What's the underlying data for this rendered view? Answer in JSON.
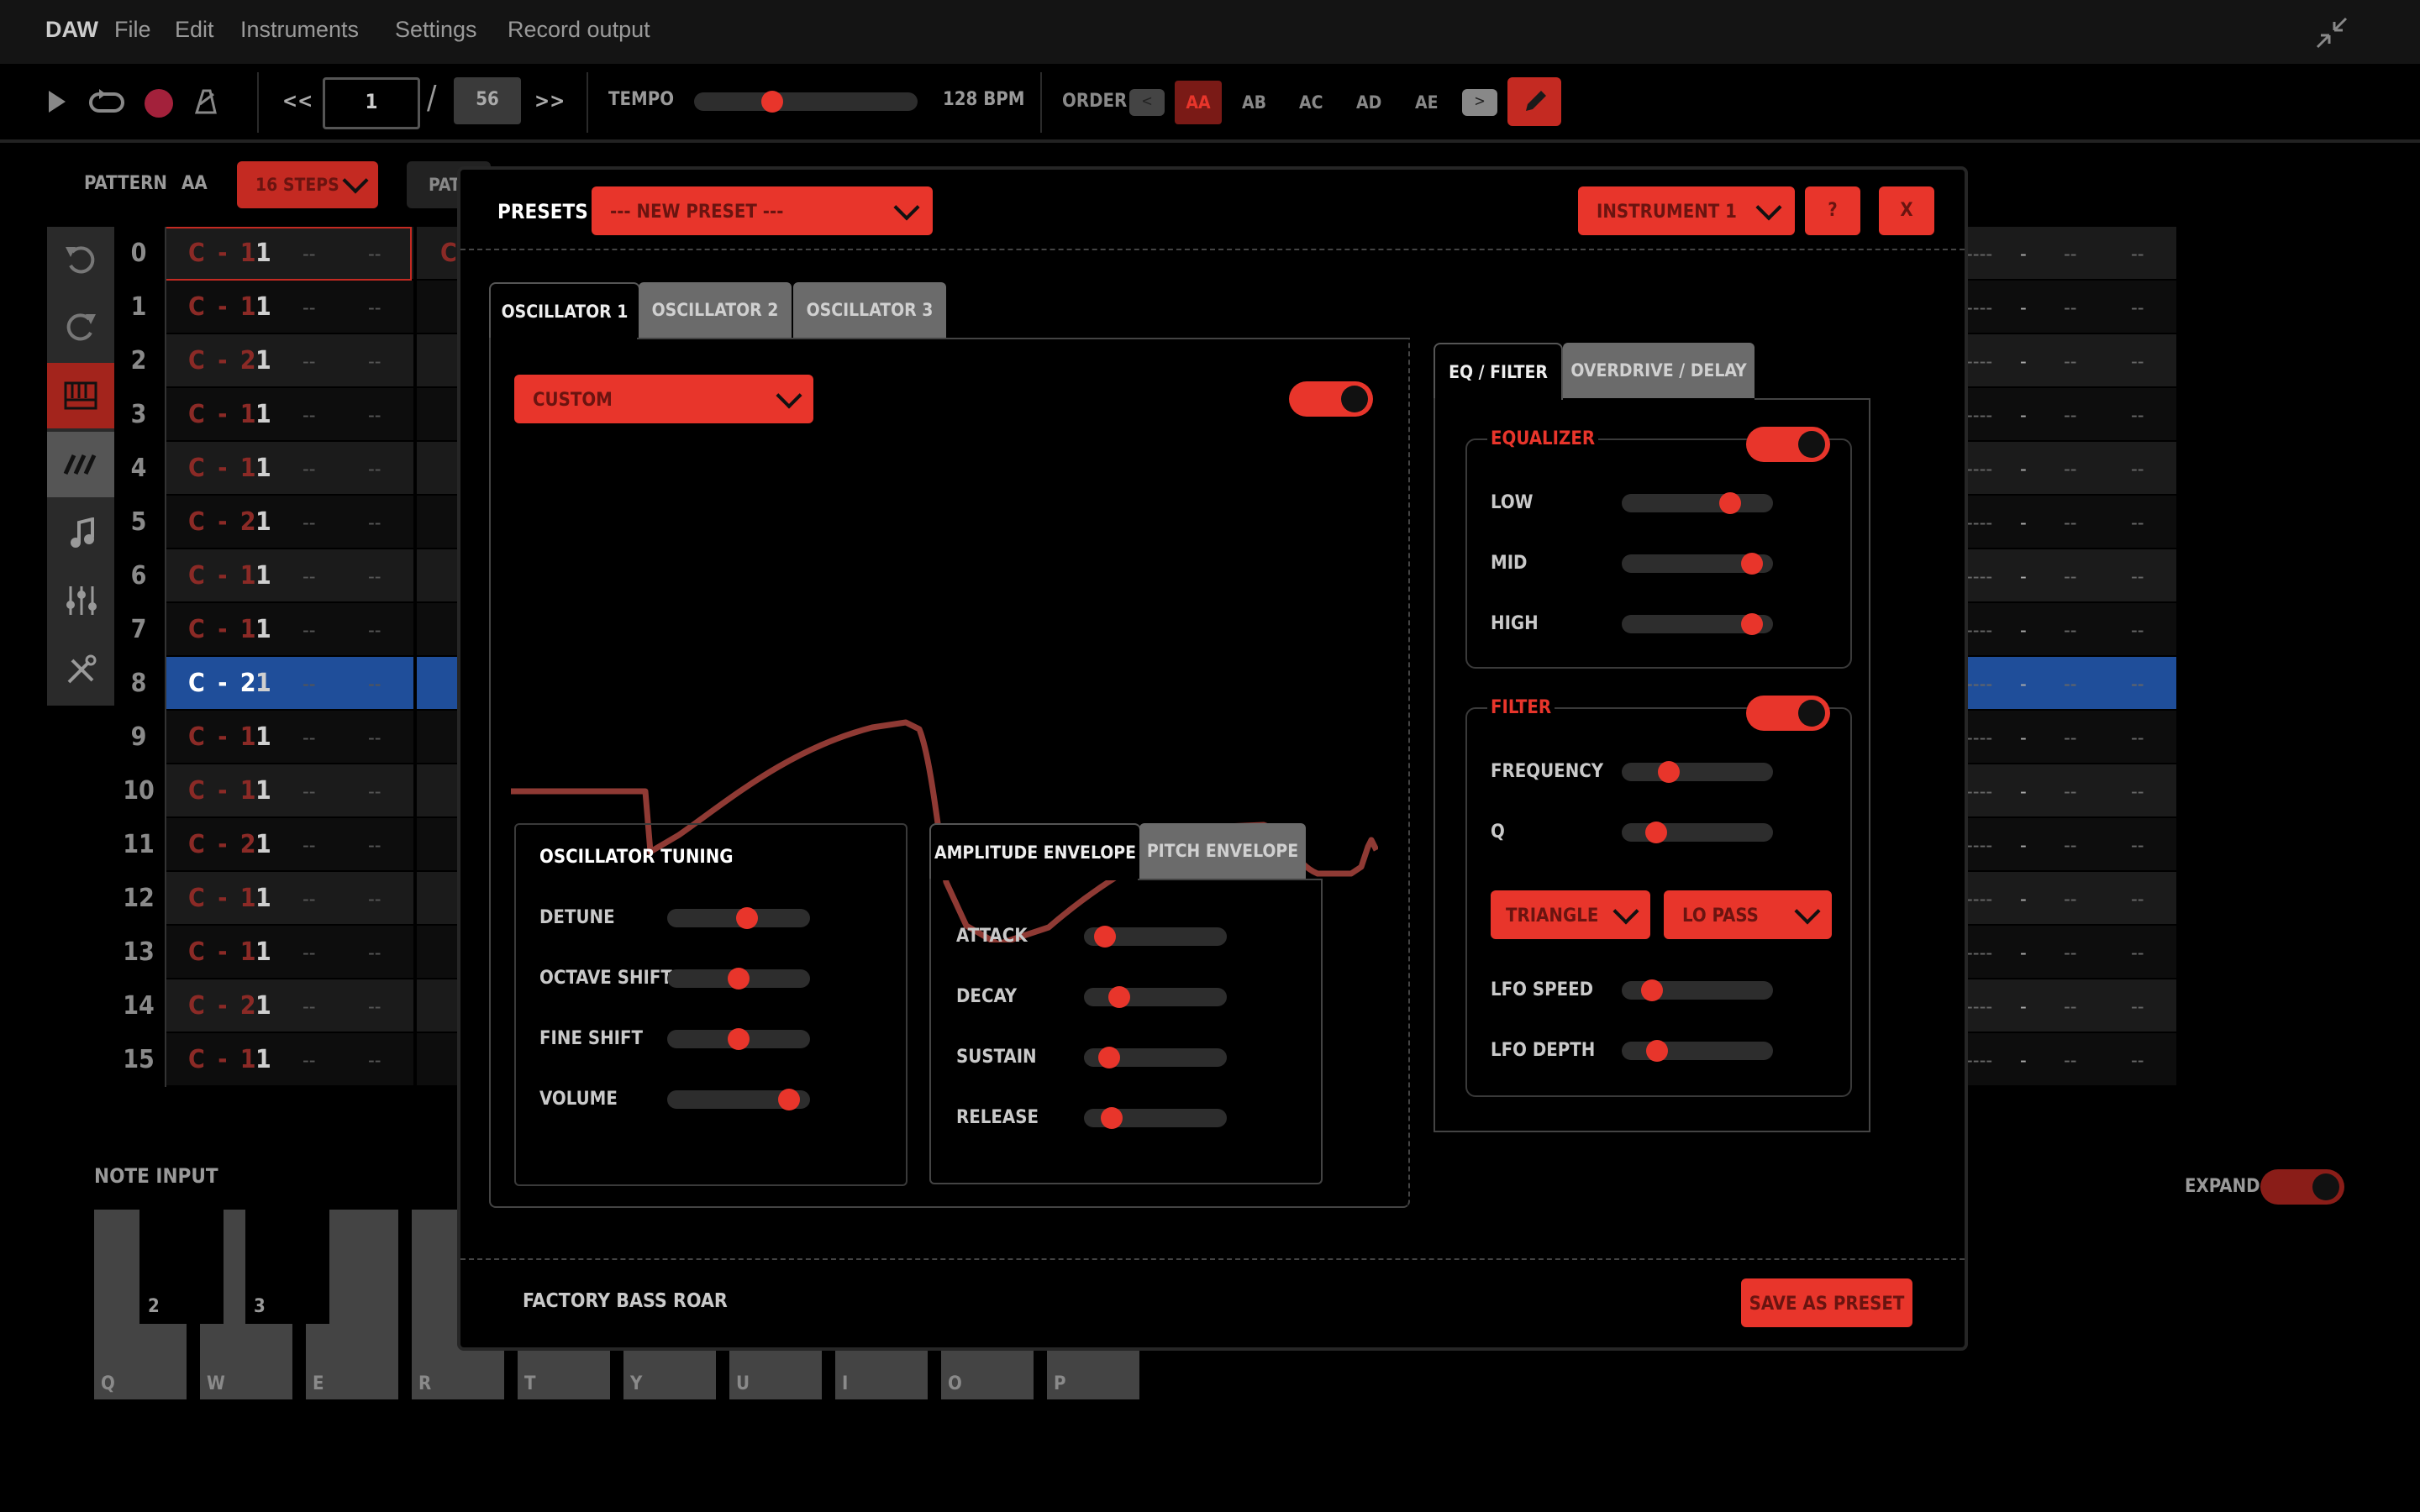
{
  "menu": {
    "app": "DAW",
    "items": [
      "File",
      "Edit",
      "Instruments",
      "Settings",
      "Record output"
    ]
  },
  "transport": {
    "position": "1",
    "total": "56",
    "prev": "<<",
    "next": ">>",
    "slash": "/",
    "tempo_label": "TEMPO",
    "tempo_value": "128 BPM",
    "order_label": "ORDER",
    "order_items": [
      "AA",
      "AB",
      "AC",
      "AD",
      "AE"
    ],
    "order_active": "AA",
    "order_back": "<",
    "order_fwd": ">"
  },
  "pattern": {
    "label": "PATTERN",
    "name": "AA",
    "steps": "16 STEPS",
    "pat_tab": "PAT",
    "rows": [
      {
        "n": "0",
        "note": "C - 1",
        "inst": "1"
      },
      {
        "n": "1",
        "note": "C - 1",
        "inst": "1"
      },
      {
        "n": "2",
        "note": "C - 2",
        "inst": "1"
      },
      {
        "n": "3",
        "note": "C - 1",
        "inst": "1"
      },
      {
        "n": "4",
        "note": "C - 1",
        "inst": "1"
      },
      {
        "n": "5",
        "note": "C - 2",
        "inst": "1"
      },
      {
        "n": "6",
        "note": "C - 1",
        "inst": "1"
      },
      {
        "n": "7",
        "note": "C - 1",
        "inst": "1"
      },
      {
        "n": "8",
        "note": "C - 2",
        "inst": "1"
      },
      {
        "n": "9",
        "note": "C - 1",
        "inst": "1"
      },
      {
        "n": "10",
        "note": "C - 1",
        "inst": "1"
      },
      {
        "n": "11",
        "note": "C - 2",
        "inst": "1"
      },
      {
        "n": "12",
        "note": "C - 1",
        "inst": "1"
      },
      {
        "n": "13",
        "note": "C - 1",
        "inst": "1"
      },
      {
        "n": "14",
        "note": "C - 2",
        "inst": "1"
      },
      {
        "n": "15",
        "note": "C - 1",
        "inst": "1"
      }
    ],
    "empty": "--",
    "empty_long": "----",
    "selected_row": "8",
    "partial_note": "C"
  },
  "note_input": {
    "label": "NOTE INPUT",
    "keys": [
      "Q",
      "W",
      "E",
      "R",
      "T",
      "Y",
      "U",
      "I",
      "O",
      "P"
    ],
    "black_keys": [
      "2",
      "3"
    ]
  },
  "expand_label": "EXPAND",
  "modal": {
    "presets_label": "PRESETS",
    "preset_value": "--- NEW PRESET ---",
    "instrument_value": "INSTRUMENT 1",
    "help": "?",
    "close": "X",
    "osc_tabs": [
      "OSCILLATOR 1",
      "OSCILLATOR 2",
      "OSCILLATOR 3"
    ],
    "waveform_select": "CUSTOM",
    "osc_enabled": true,
    "tuning": {
      "title": "OSCILLATOR TUNING",
      "params": [
        {
          "label": "DETUNE",
          "value": 0.57
        },
        {
          "label": "OCTAVE SHIFT",
          "value": 0.5
        },
        {
          "label": "FINE SHIFT",
          "value": 0.5
        },
        {
          "label": "VOLUME",
          "value": 0.92
        }
      ]
    },
    "env_tabs": [
      "AMPLITUDE ENVELOPE",
      "PITCH ENVELOPE"
    ],
    "envelope": [
      {
        "label": "ATTACK",
        "value": 0.08
      },
      {
        "label": "DECAY",
        "value": 0.2
      },
      {
        "label": "SUSTAIN",
        "value": 0.12
      },
      {
        "label": "RELEASE",
        "value": 0.14
      }
    ],
    "fx_tabs": [
      "EQ / FILTER",
      "OVERDRIVE / DELAY"
    ],
    "equalizer": {
      "title": "EQUALIZER",
      "enabled": true,
      "params": [
        {
          "label": "LOW",
          "value": 0.75
        },
        {
          "label": "MID",
          "value": 0.92
        },
        {
          "label": "HIGH",
          "value": 0.92
        }
      ]
    },
    "filter": {
      "title": "FILTER",
      "enabled": true,
      "params_top": [
        {
          "label": "FREQUENCY",
          "value": 0.28
        },
        {
          "label": "Q",
          "value": 0.18
        }
      ],
      "lfo_shape": "TRIANGLE",
      "filter_type": "LO PASS",
      "params_bottom": [
        {
          "label": "LFO SPEED",
          "value": 0.15
        },
        {
          "label": "LFO DEPTH",
          "value": 0.19
        }
      ]
    },
    "preset_name": "FACTORY BASS ROAR",
    "save_label": "SAVE AS PRESET"
  },
  "colors": {
    "accent": "#e8352b",
    "selected_row": "#1f4e9a",
    "background": "#000000"
  }
}
